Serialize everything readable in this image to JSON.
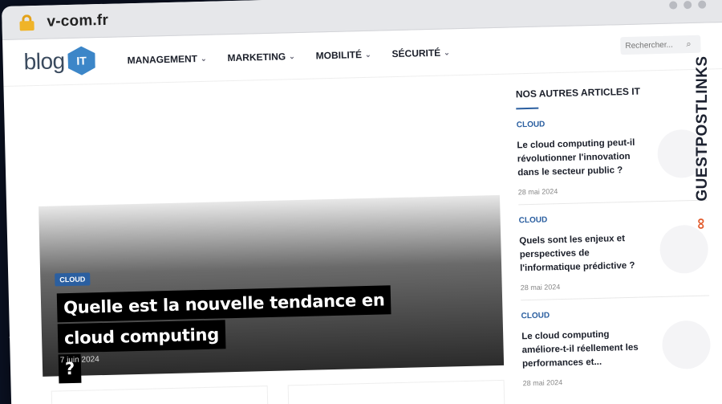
{
  "browser": {
    "url": "v-com.fr"
  },
  "site": {
    "logo_text": "blog",
    "logo_badge": "IT",
    "nav": [
      {
        "label": "MANAGEMENT"
      },
      {
        "label": "MARKETING"
      },
      {
        "label": "MOBILITÉ"
      },
      {
        "label": "SÉCURITÉ"
      }
    ],
    "search_placeholder": "Rechercher..."
  },
  "featured": {
    "category": "CLOUD",
    "title_line1": "Quelle est la nouvelle tendance en cloud computing",
    "title_line2": "?",
    "date": "7 juin 2024"
  },
  "sidebar": {
    "heading": "NOS AUTRES ARTICLES IT",
    "articles": [
      {
        "category": "CLOUD",
        "title": "Le cloud computing peut-il révolutionner l'innovation dans le secteur public ?",
        "date": "28 mai 2024"
      },
      {
        "category": "CLOUD",
        "title": "Quels sont les enjeux et perspectives de l'informatique prédictive ?",
        "date": "28 mai 2024"
      },
      {
        "category": "CLOUD",
        "title": "Le cloud computing améliore-t-il réellement les performances et...",
        "date": "28 mai 2024"
      }
    ]
  },
  "watermark": {
    "text": "GUESTPOSTLINKS",
    "icon": "link-icon"
  },
  "colors": {
    "accent": "#2b5fa0",
    "watermark_icon": "#e25a2b"
  }
}
